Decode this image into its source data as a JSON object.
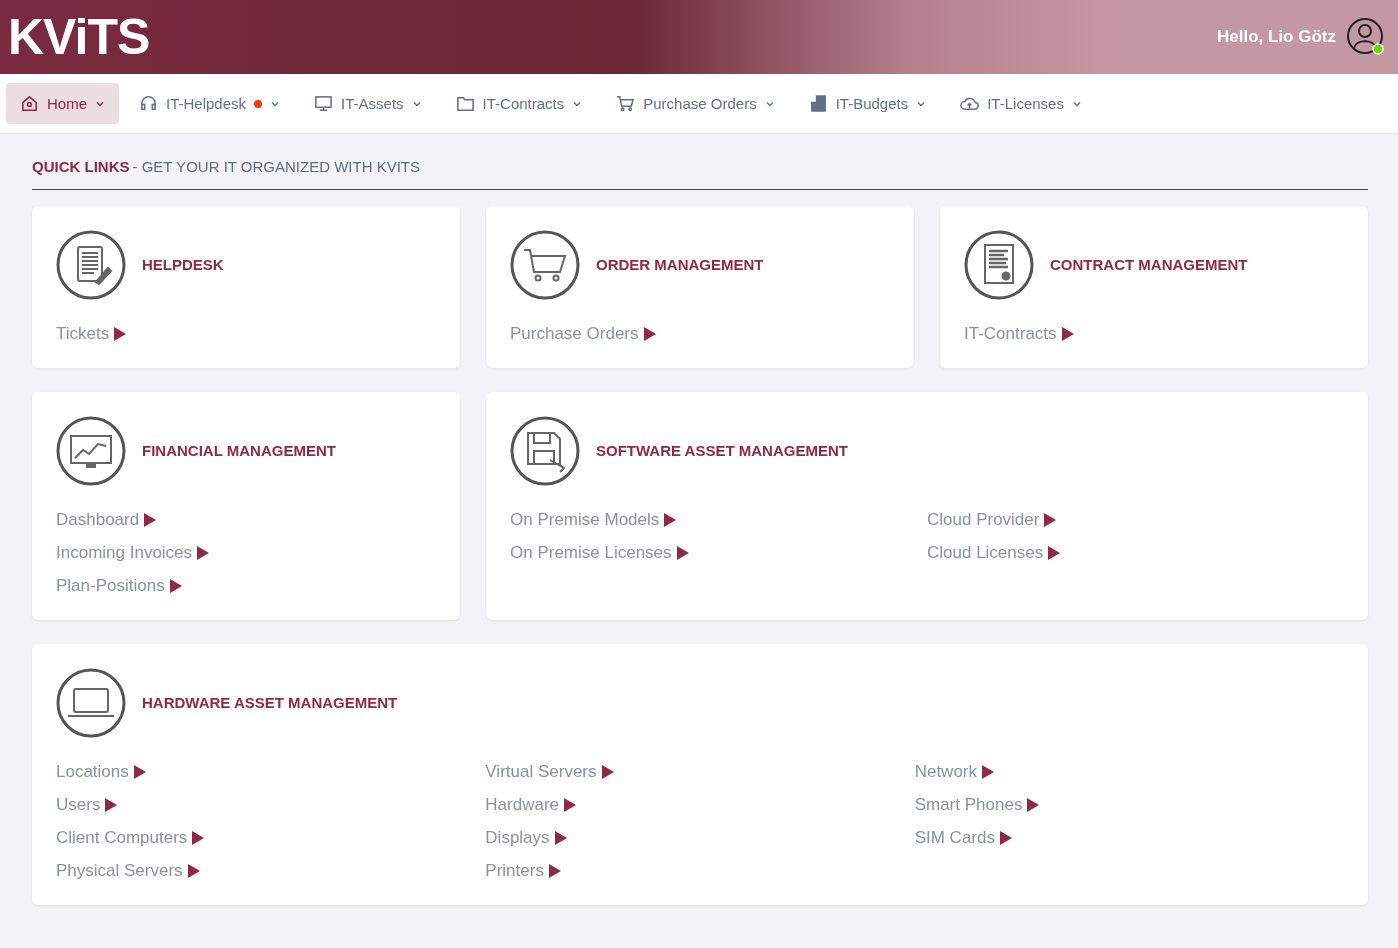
{
  "header": {
    "logo": "KViTS",
    "greeting": "Hello, Lio Götz",
    "user_online": true
  },
  "nav": [
    {
      "label": "Home",
      "selected": true,
      "notification": false
    },
    {
      "label": "IT-Helpdesk",
      "selected": false,
      "notification": true
    },
    {
      "label": "IT-Assets",
      "selected": false,
      "notification": false
    },
    {
      "label": "IT-Contracts",
      "selected": false,
      "notification": false
    },
    {
      "label": "Purchase Orders",
      "selected": false,
      "notification": false
    },
    {
      "label": "IT-Budgets",
      "selected": false,
      "notification": false
    },
    {
      "label": "IT-Licenses",
      "selected": false,
      "notification": false
    }
  ],
  "section": {
    "title": "QUICK LINKS",
    "subtitle": "- GET YOUR IT ORGANIZED WITH KVITS"
  },
  "cards": [
    {
      "title": "HELPDESK",
      "columns": [
        [
          "Tickets"
        ]
      ]
    },
    {
      "title": "ORDER MANAGEMENT",
      "columns": [
        [
          "Purchase Orders"
        ]
      ]
    },
    {
      "title": "CONTRACT MANAGEMENT",
      "columns": [
        [
          "IT-Contracts"
        ]
      ]
    },
    {
      "title": "FINANCIAL MANAGEMENT",
      "columns": [
        [
          "Dashboard",
          "Incoming Invoices",
          "Plan-Positions"
        ]
      ]
    },
    {
      "title": "SOFTWARE ASSET MANAGEMENT",
      "columns": [
        [
          "On Premise Models",
          "On Premise Licenses"
        ],
        [
          "Cloud Provider",
          "Cloud Licenses"
        ]
      ]
    },
    {
      "title": "HARDWARE ASSET MANAGEMENT",
      "columns": [
        [
          "Locations",
          "Users",
          "Client Computers",
          "Physical Servers"
        ],
        [
          "Virtual Servers",
          "Hardware",
          "Displays",
          "Printers"
        ],
        [
          "Network",
          "Smart Phones",
          "SIM Cards"
        ]
      ]
    }
  ]
}
